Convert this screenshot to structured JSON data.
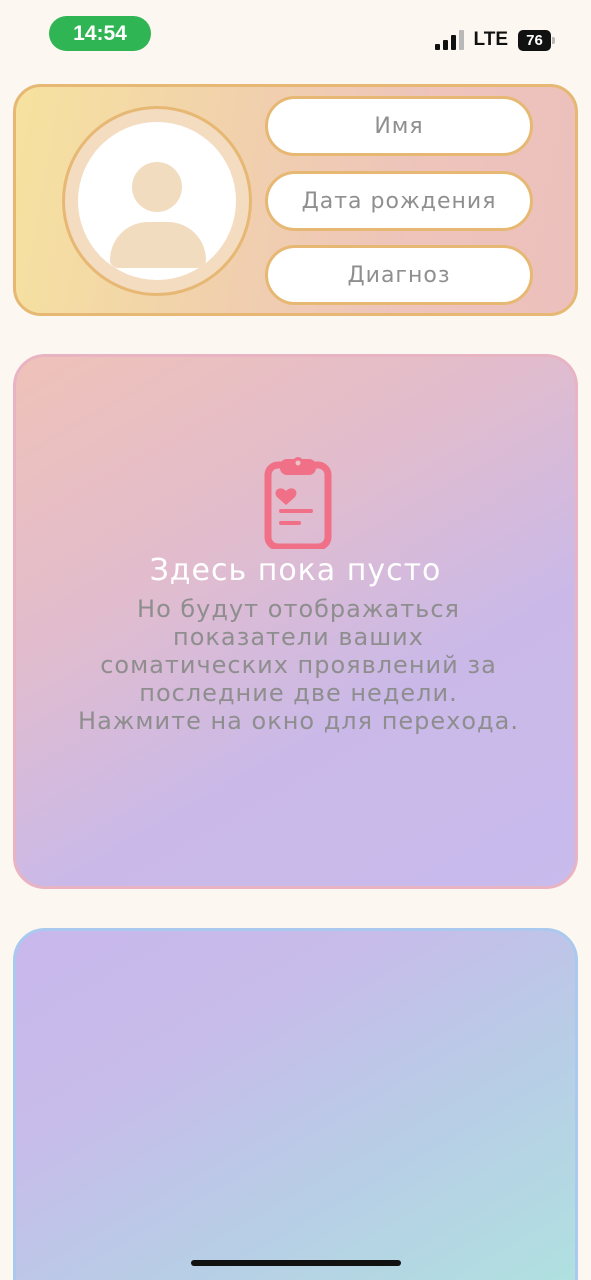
{
  "status_bar": {
    "time": "14:54",
    "network": "LTE",
    "battery": "76"
  },
  "profile": {
    "name_label": "Имя",
    "birthdate_label": "Дата рождения",
    "diagnosis_label": "Диагноз"
  },
  "somatic_panel": {
    "icon": "clipboard-heart-icon",
    "title": "Здесь пока пусто",
    "description": "Но будут отображаться показатели ваших соматических проявлений за последние две недели. Нажмите на окно для перехода."
  },
  "colors": {
    "status_green": "#2fb553",
    "accent_border": "#e6b873",
    "clipboard_pink": "#f07087",
    "page_background": "#fdf7f1"
  }
}
